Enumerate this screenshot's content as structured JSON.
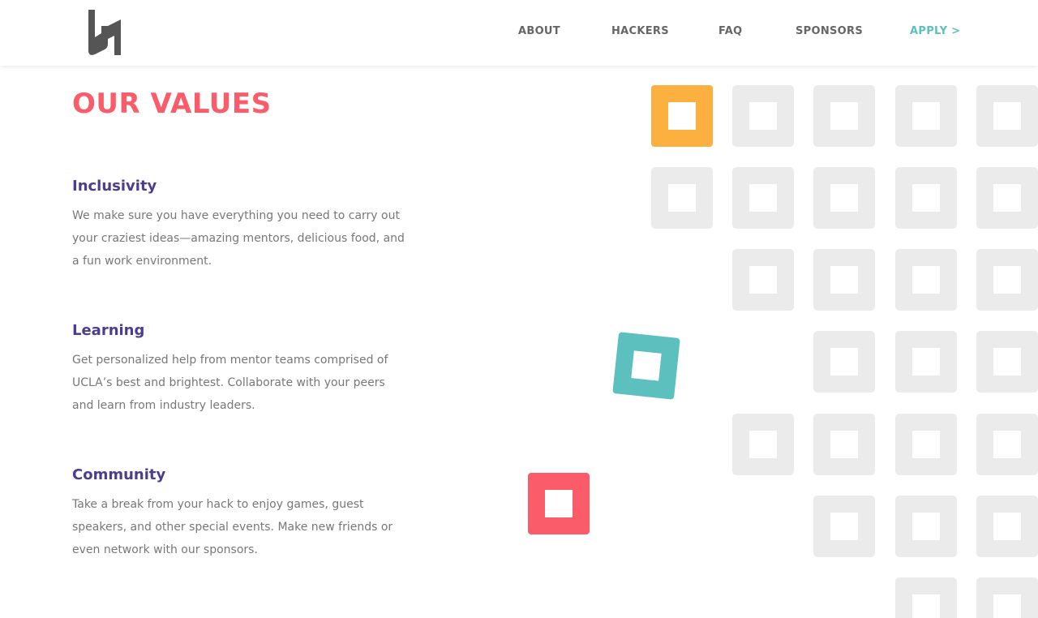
{
  "colors": {
    "accent_red": "#fb5c6a",
    "heading_purple": "#4b3d8f",
    "link_teal": "#5cc0bf",
    "tile_yellow": "#fbb040",
    "tile_grey": "#ebebeb",
    "nav_text": "#666666"
  },
  "header": {
    "logo_icon": "lh-logo-icon",
    "nav": [
      {
        "label": "ABOUT"
      },
      {
        "label": "HACKERS"
      },
      {
        "label": "FAQ"
      },
      {
        "label": "SPONSORS"
      },
      {
        "label": "APPLY >"
      }
    ]
  },
  "main": {
    "title": "OUR VALUES",
    "values": [
      {
        "heading": "Inclusivity",
        "text": "We make sure you have everything you need to carry out your craziest ideas—amazing mentors, delicious food, and a fun work environment."
      },
      {
        "heading": "Learning",
        "text": "Get personalized help from mentor teams comprised of UCLA’s best and brightest. Collaborate with your peers and learn from industry leaders."
      },
      {
        "heading": "Community",
        "text": "Take a break from your hack to enjoy games, guest speakers, and other special events. Make new friends or even network with our sponsors."
      }
    ]
  },
  "decoration": {
    "icon": "hollow-square-icon",
    "colored_squares": [
      "yellow",
      "teal",
      "red"
    ]
  }
}
